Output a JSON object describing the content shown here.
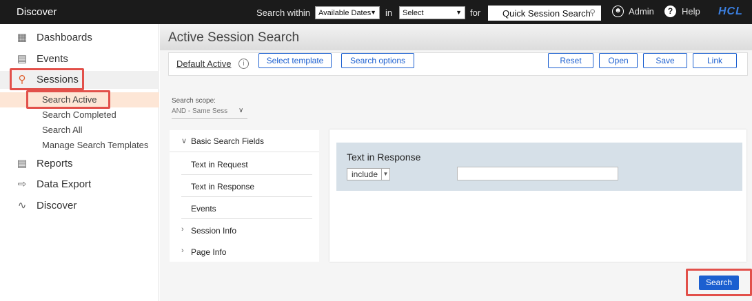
{
  "topbar": {
    "brand": "Discover",
    "search_within_label": "Search within",
    "search_within_value": "Available Dates",
    "in_label": "in",
    "in_value": "Select",
    "for_label": "for",
    "quick_search_label": "Quick Session Search",
    "admin_label": "Admin",
    "help_label": "Help",
    "logo_text": "HCL"
  },
  "sidebar": {
    "items": [
      {
        "label": "Dashboards",
        "icon": "dashboard-icon"
      },
      {
        "label": "Events",
        "icon": "calendar-icon"
      },
      {
        "label": "Sessions",
        "icon": "search-icon"
      },
      {
        "label": "Reports",
        "icon": "report-icon"
      },
      {
        "label": "Data Export",
        "icon": "export-icon"
      },
      {
        "label": "Discover",
        "icon": "discover-icon"
      }
    ],
    "session_subitems": [
      {
        "label": "Search Active"
      },
      {
        "label": "Search Completed"
      },
      {
        "label": "Search All"
      },
      {
        "label": "Manage Search Templates"
      }
    ]
  },
  "main": {
    "title": "Active Session Search",
    "toolbar": {
      "template_name": "Default Active",
      "select_template": "Select template",
      "search_options": "Search options",
      "reset": "Reset",
      "open": "Open",
      "save": "Save",
      "link": "Link"
    },
    "scope": {
      "label": "Search scope:",
      "value": "AND - Same Sess"
    },
    "fields": {
      "group_label": "Basic Search Fields",
      "items": [
        "Text in Request",
        "Text in Response",
        "Events"
      ],
      "session_info": "Session Info",
      "page_info": "Page Info"
    },
    "criteria": {
      "title": "Text in Response",
      "operator": "include",
      "value": ""
    },
    "search_button": "Search"
  },
  "colors": {
    "accent": "#1b5fd0",
    "highlight": "#e2504a",
    "topbar": "#1b1b1b",
    "active_sub": "#fde6d6"
  }
}
